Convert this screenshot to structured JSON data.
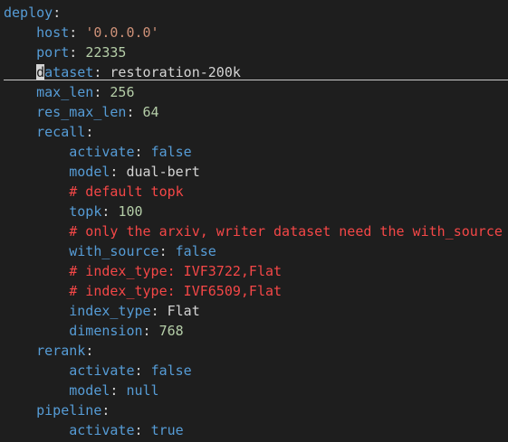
{
  "editor": {
    "lines": [
      [
        {
          "t": "deploy",
          "c": "key"
        },
        {
          "t": ":",
          "c": "plain"
        }
      ],
      [
        {
          "t": "    ",
          "c": "plain"
        },
        {
          "t": "host",
          "c": "key"
        },
        {
          "t": ": ",
          "c": "plain"
        },
        {
          "t": "'0.0.0.0'",
          "c": "str"
        }
      ],
      [
        {
          "t": "    ",
          "c": "plain"
        },
        {
          "t": "port",
          "c": "key"
        },
        {
          "t": ": ",
          "c": "plain"
        },
        {
          "t": "22335",
          "c": "num"
        }
      ],
      [
        {
          "t": "    ",
          "c": "plain"
        },
        {
          "t": "d",
          "c": "cursor-char"
        },
        {
          "t": "ataset",
          "c": "key"
        },
        {
          "t": ": ",
          "c": "plain"
        },
        {
          "t": "restoration-200k",
          "c": "plain"
        }
      ],
      [
        {
          "t": "    ",
          "c": "plain"
        },
        {
          "t": "max_len",
          "c": "key"
        },
        {
          "t": ": ",
          "c": "plain"
        },
        {
          "t": "256",
          "c": "num"
        }
      ],
      [
        {
          "t": "    ",
          "c": "plain"
        },
        {
          "t": "res_max_len",
          "c": "key"
        },
        {
          "t": ": ",
          "c": "plain"
        },
        {
          "t": "64",
          "c": "num"
        }
      ],
      [
        {
          "t": "    ",
          "c": "plain"
        },
        {
          "t": "recall",
          "c": "key"
        },
        {
          "t": ":",
          "c": "plain"
        }
      ],
      [
        {
          "t": "        ",
          "c": "plain"
        },
        {
          "t": "activate",
          "c": "key"
        },
        {
          "t": ": ",
          "c": "plain"
        },
        {
          "t": "false",
          "c": "bool"
        }
      ],
      [
        {
          "t": "        ",
          "c": "plain"
        },
        {
          "t": "model",
          "c": "key"
        },
        {
          "t": ": ",
          "c": "plain"
        },
        {
          "t": "dual-bert",
          "c": "plain"
        }
      ],
      [
        {
          "t": "        ",
          "c": "plain"
        },
        {
          "t": "# default topk",
          "c": "comment"
        }
      ],
      [
        {
          "t": "        ",
          "c": "plain"
        },
        {
          "t": "topk",
          "c": "key"
        },
        {
          "t": ": ",
          "c": "plain"
        },
        {
          "t": "100",
          "c": "num"
        }
      ],
      [
        {
          "t": "        ",
          "c": "plain"
        },
        {
          "t": "# only the arxiv, writer dataset need the with_source",
          "c": "comment"
        }
      ],
      [
        {
          "t": "        ",
          "c": "plain"
        },
        {
          "t": "with_source",
          "c": "key"
        },
        {
          "t": ": ",
          "c": "plain"
        },
        {
          "t": "false",
          "c": "bool"
        }
      ],
      [
        {
          "t": "        ",
          "c": "plain"
        },
        {
          "t": "# index_type: IVF3722,Flat",
          "c": "comment"
        }
      ],
      [
        {
          "t": "        ",
          "c": "plain"
        },
        {
          "t": "# index_type: IVF6509,Flat",
          "c": "comment"
        }
      ],
      [
        {
          "t": "        ",
          "c": "plain"
        },
        {
          "t": "index_type",
          "c": "key"
        },
        {
          "t": ": ",
          "c": "plain"
        },
        {
          "t": "Flat",
          "c": "plain"
        }
      ],
      [
        {
          "t": "        ",
          "c": "plain"
        },
        {
          "t": "dimension",
          "c": "key"
        },
        {
          "t": ": ",
          "c": "plain"
        },
        {
          "t": "768",
          "c": "num"
        }
      ],
      [
        {
          "t": "    ",
          "c": "plain"
        },
        {
          "t": "rerank",
          "c": "key"
        },
        {
          "t": ":",
          "c": "plain"
        }
      ],
      [
        {
          "t": "        ",
          "c": "plain"
        },
        {
          "t": "activate",
          "c": "key"
        },
        {
          "t": ": ",
          "c": "plain"
        },
        {
          "t": "false",
          "c": "bool"
        }
      ],
      [
        {
          "t": "        ",
          "c": "plain"
        },
        {
          "t": "model",
          "c": "key"
        },
        {
          "t": ": ",
          "c": "plain"
        },
        {
          "t": "null",
          "c": "bool"
        }
      ],
      [
        {
          "t": "    ",
          "c": "plain"
        },
        {
          "t": "pipeline",
          "c": "key"
        },
        {
          "t": ":",
          "c": "plain"
        }
      ],
      [
        {
          "t": "        ",
          "c": "plain"
        },
        {
          "t": "activate",
          "c": "key"
        },
        {
          "t": ": ",
          "c": "plain"
        },
        {
          "t": "true",
          "c": "bool"
        }
      ]
    ]
  },
  "colors": {
    "background": "#1e1e1e",
    "key": "#569cd6",
    "string": "#ce9178",
    "number": "#b5cea8",
    "comment": "#f44747",
    "plain": "#d4d4d4"
  }
}
